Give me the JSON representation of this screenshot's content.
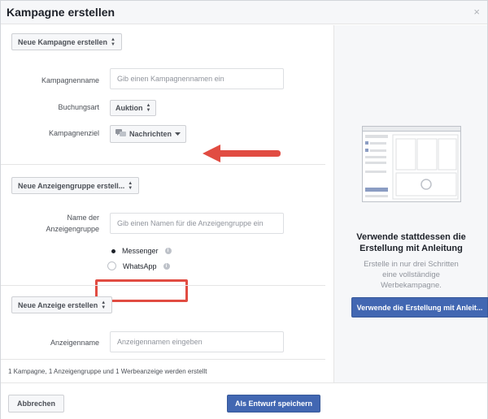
{
  "dialog": {
    "title": "Kampagne erstellen",
    "close_icon": "×"
  },
  "campaign_section": {
    "button_label": "Neue Kampagne erstellen",
    "name_label": "Kampagnenname",
    "name_placeholder": "Gib einen Kampagnennamen ein",
    "buying_type_label": "Buchungsart",
    "buying_type_value": "Auktion",
    "objective_label": "Kampagnenziel",
    "objective_value": "Nachrichten"
  },
  "adset_section": {
    "button_label": "Neue Anzeigengruppe erstell...",
    "name_label_line1": "Name der",
    "name_label_line2": "Anzeigengruppe",
    "name_placeholder": "Gib einen Namen für die Anzeigengruppe ein",
    "options": [
      {
        "label": "Messenger",
        "selected": true
      },
      {
        "label": "WhatsApp",
        "selected": false
      }
    ]
  },
  "ad_section": {
    "button_label": "Neue Anzeige erstellen",
    "name_label": "Anzeigenname",
    "name_placeholder": "Anzeigennamen eingeben"
  },
  "summary": "1 Kampagne, 1 Anzeigengruppe und 1 Werbeanzeige werden erstellt",
  "footer": {
    "cancel_label": "Abbrechen",
    "save_label": "Als Entwurf speichern"
  },
  "promo": {
    "title_line1": "Verwende stattdessen die",
    "title_line2": "Erstellung mit Anleitung",
    "text_line1": "Erstelle in nur drei Schritten",
    "text_line2": "eine vollständige",
    "text_line3": "Werbekampagne.",
    "button_label": "Verwende die Erstellung mit Anleit..."
  },
  "colors": {
    "primary": "#4267b2",
    "annotation_red": "#e14c42",
    "panel_bg": "#f6f7f9"
  },
  "icons": {
    "updown_caret": "⬍",
    "chat_icon": "chat-bubbles-icon",
    "dropdown_icon": "caret-down-icon",
    "info_icon": "info-icon",
    "arrow": "red-arrow-left-icon"
  }
}
